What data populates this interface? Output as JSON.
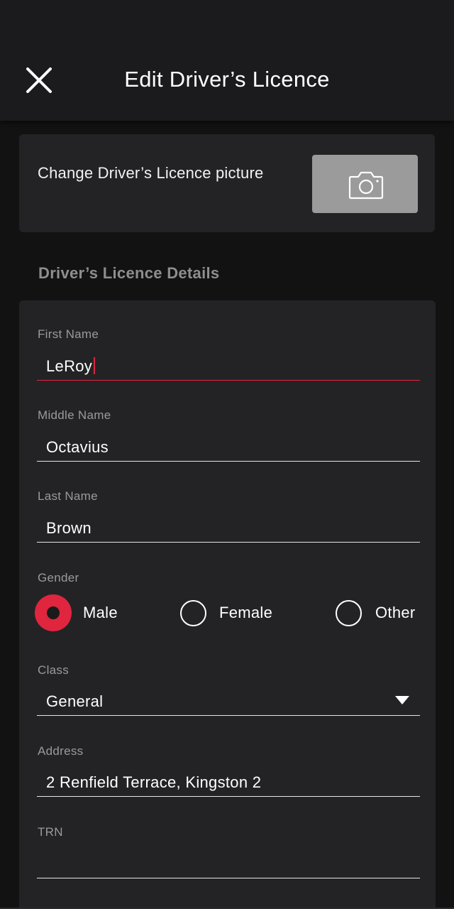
{
  "header": {
    "title": "Edit Driver’s Licence",
    "close_icon": "close-icon"
  },
  "photo_card": {
    "label": "Change Driver’s Licence picture",
    "camera_icon": "camera-icon"
  },
  "section": {
    "heading": "Driver’s Licence Details"
  },
  "form": {
    "first_name": {
      "label": "First Name",
      "value": "LeRoy"
    },
    "middle_name": {
      "label": "Middle Name",
      "value": "Octavius"
    },
    "last_name": {
      "label": "Last Name",
      "value": "Brown"
    },
    "gender": {
      "label": "Gender",
      "options": [
        "Male",
        "Female",
        "Other"
      ],
      "selected": "Male"
    },
    "class": {
      "label": "Class",
      "value": "General"
    },
    "address": {
      "label": "Address",
      "value": "2 Renfield Terrace, Kingston 2"
    },
    "trn": {
      "label": "TRN",
      "value": ""
    }
  },
  "colors": {
    "accent": "#e0253f",
    "background": "#121212",
    "card": "#232325",
    "camera_button": "#9b9b9b"
  }
}
